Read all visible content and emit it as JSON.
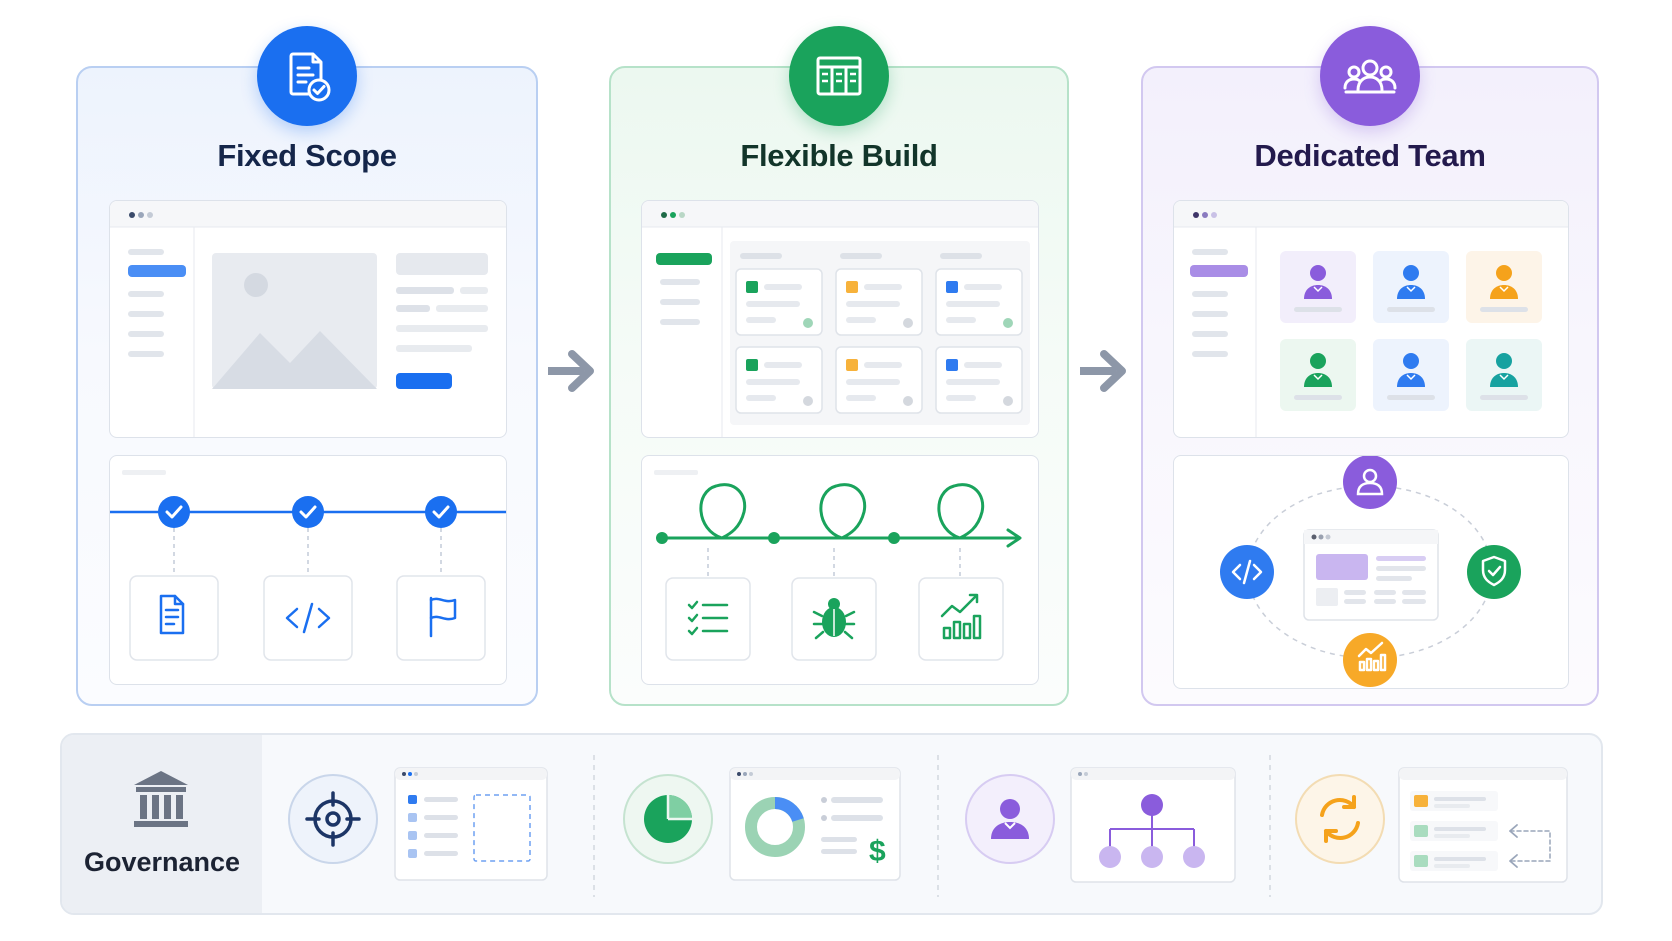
{
  "panels": [
    {
      "title": "Fixed Scope",
      "accent": "#1a6ff0",
      "icon": "document-check-icon"
    },
    {
      "title": "Flexible Build",
      "accent": "#1aa35c",
      "icon": "kanban-board-icon"
    },
    {
      "title": "Dedicated Team",
      "accent": "#8a5cdc",
      "icon": "team-icon"
    }
  ],
  "governance": {
    "label": "Governance",
    "icon": "bank-building-icon",
    "items": [
      "target-icon",
      "pie-chart-icon",
      "user-icon",
      "sync-icon"
    ]
  },
  "colors": {
    "blue": "#1a6ff0",
    "green": "#1aa35c",
    "purple": "#8a5cdc",
    "orange": "#f7a928",
    "teal": "#17a2a0"
  }
}
